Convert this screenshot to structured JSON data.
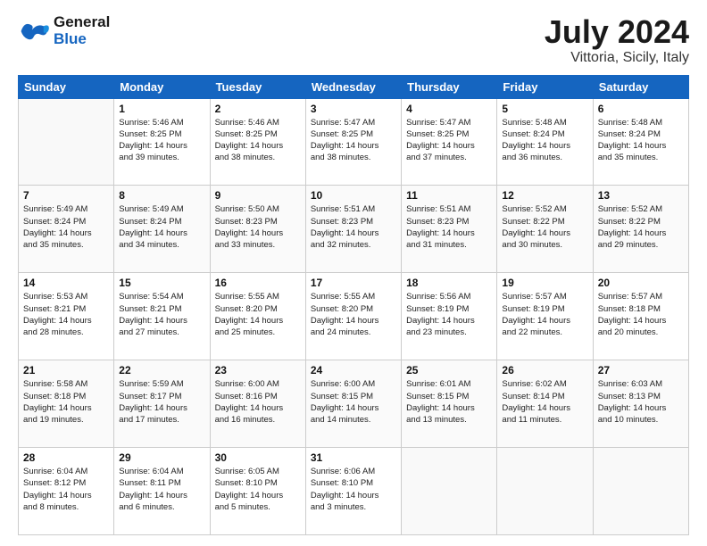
{
  "logo": {
    "line1": "General",
    "line2": "Blue"
  },
  "title": "July 2024",
  "subtitle": "Vittoria, Sicily, Italy",
  "header": {
    "days": [
      "Sunday",
      "Monday",
      "Tuesday",
      "Wednesday",
      "Thursday",
      "Friday",
      "Saturday"
    ]
  },
  "weeks": [
    [
      {
        "day": "",
        "info": ""
      },
      {
        "day": "1",
        "info": "Sunrise: 5:46 AM\nSunset: 8:25 PM\nDaylight: 14 hours\nand 39 minutes."
      },
      {
        "day": "2",
        "info": "Sunrise: 5:46 AM\nSunset: 8:25 PM\nDaylight: 14 hours\nand 38 minutes."
      },
      {
        "day": "3",
        "info": "Sunrise: 5:47 AM\nSunset: 8:25 PM\nDaylight: 14 hours\nand 38 minutes."
      },
      {
        "day": "4",
        "info": "Sunrise: 5:47 AM\nSunset: 8:25 PM\nDaylight: 14 hours\nand 37 minutes."
      },
      {
        "day": "5",
        "info": "Sunrise: 5:48 AM\nSunset: 8:24 PM\nDaylight: 14 hours\nand 36 minutes."
      },
      {
        "day": "6",
        "info": "Sunrise: 5:48 AM\nSunset: 8:24 PM\nDaylight: 14 hours\nand 35 minutes."
      }
    ],
    [
      {
        "day": "7",
        "info": "Sunrise: 5:49 AM\nSunset: 8:24 PM\nDaylight: 14 hours\nand 35 minutes."
      },
      {
        "day": "8",
        "info": "Sunrise: 5:49 AM\nSunset: 8:24 PM\nDaylight: 14 hours\nand 34 minutes."
      },
      {
        "day": "9",
        "info": "Sunrise: 5:50 AM\nSunset: 8:23 PM\nDaylight: 14 hours\nand 33 minutes."
      },
      {
        "day": "10",
        "info": "Sunrise: 5:51 AM\nSunset: 8:23 PM\nDaylight: 14 hours\nand 32 minutes."
      },
      {
        "day": "11",
        "info": "Sunrise: 5:51 AM\nSunset: 8:23 PM\nDaylight: 14 hours\nand 31 minutes."
      },
      {
        "day": "12",
        "info": "Sunrise: 5:52 AM\nSunset: 8:22 PM\nDaylight: 14 hours\nand 30 minutes."
      },
      {
        "day": "13",
        "info": "Sunrise: 5:52 AM\nSunset: 8:22 PM\nDaylight: 14 hours\nand 29 minutes."
      }
    ],
    [
      {
        "day": "14",
        "info": "Sunrise: 5:53 AM\nSunset: 8:21 PM\nDaylight: 14 hours\nand 28 minutes."
      },
      {
        "day": "15",
        "info": "Sunrise: 5:54 AM\nSunset: 8:21 PM\nDaylight: 14 hours\nand 27 minutes."
      },
      {
        "day": "16",
        "info": "Sunrise: 5:55 AM\nSunset: 8:20 PM\nDaylight: 14 hours\nand 25 minutes."
      },
      {
        "day": "17",
        "info": "Sunrise: 5:55 AM\nSunset: 8:20 PM\nDaylight: 14 hours\nand 24 minutes."
      },
      {
        "day": "18",
        "info": "Sunrise: 5:56 AM\nSunset: 8:19 PM\nDaylight: 14 hours\nand 23 minutes."
      },
      {
        "day": "19",
        "info": "Sunrise: 5:57 AM\nSunset: 8:19 PM\nDaylight: 14 hours\nand 22 minutes."
      },
      {
        "day": "20",
        "info": "Sunrise: 5:57 AM\nSunset: 8:18 PM\nDaylight: 14 hours\nand 20 minutes."
      }
    ],
    [
      {
        "day": "21",
        "info": "Sunrise: 5:58 AM\nSunset: 8:18 PM\nDaylight: 14 hours\nand 19 minutes."
      },
      {
        "day": "22",
        "info": "Sunrise: 5:59 AM\nSunset: 8:17 PM\nDaylight: 14 hours\nand 17 minutes."
      },
      {
        "day": "23",
        "info": "Sunrise: 6:00 AM\nSunset: 8:16 PM\nDaylight: 14 hours\nand 16 minutes."
      },
      {
        "day": "24",
        "info": "Sunrise: 6:00 AM\nSunset: 8:15 PM\nDaylight: 14 hours\nand 14 minutes."
      },
      {
        "day": "25",
        "info": "Sunrise: 6:01 AM\nSunset: 8:15 PM\nDaylight: 14 hours\nand 13 minutes."
      },
      {
        "day": "26",
        "info": "Sunrise: 6:02 AM\nSunset: 8:14 PM\nDaylight: 14 hours\nand 11 minutes."
      },
      {
        "day": "27",
        "info": "Sunrise: 6:03 AM\nSunset: 8:13 PM\nDaylight: 14 hours\nand 10 minutes."
      }
    ],
    [
      {
        "day": "28",
        "info": "Sunrise: 6:04 AM\nSunset: 8:12 PM\nDaylight: 14 hours\nand 8 minutes."
      },
      {
        "day": "29",
        "info": "Sunrise: 6:04 AM\nSunset: 8:11 PM\nDaylight: 14 hours\nand 6 minutes."
      },
      {
        "day": "30",
        "info": "Sunrise: 6:05 AM\nSunset: 8:10 PM\nDaylight: 14 hours\nand 5 minutes."
      },
      {
        "day": "31",
        "info": "Sunrise: 6:06 AM\nSunset: 8:10 PM\nDaylight: 14 hours\nand 3 minutes."
      },
      {
        "day": "",
        "info": ""
      },
      {
        "day": "",
        "info": ""
      },
      {
        "day": "",
        "info": ""
      }
    ]
  ]
}
